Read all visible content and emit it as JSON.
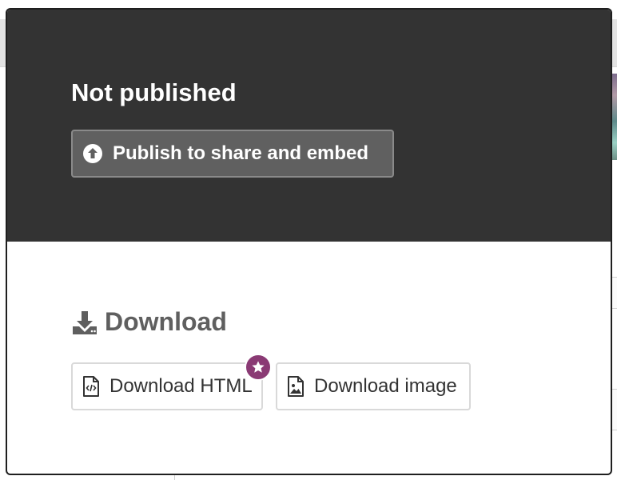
{
  "publish": {
    "title": "Not published",
    "button_label": "Publish to share and embed",
    "button_icon": "upload-circle-icon"
  },
  "download": {
    "heading": "Download",
    "heading_icon": "download-icon",
    "buttons": [
      {
        "label": "Download HTML",
        "icon": "file-code-icon",
        "premium": true
      },
      {
        "label": "Download image",
        "icon": "file-image-icon",
        "premium": false
      }
    ]
  },
  "colors": {
    "publish_panel_bg": "#333333",
    "publish_button_bg": "#606060",
    "premium_badge": "#8a3a74",
    "heading_text": "#5f5f5f"
  }
}
